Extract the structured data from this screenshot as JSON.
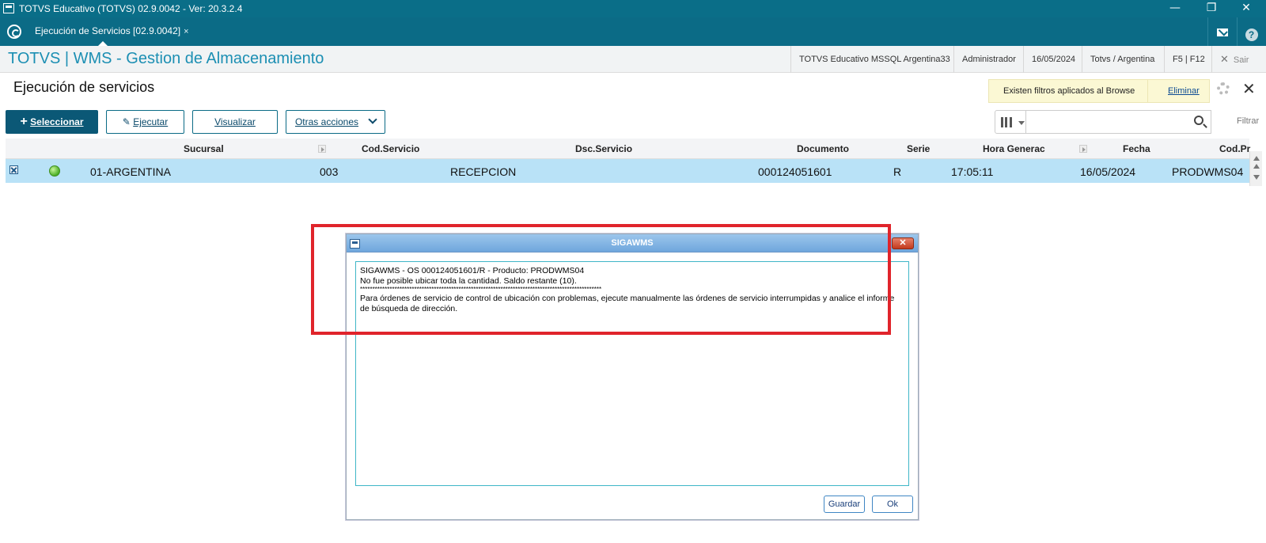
{
  "window": {
    "title": "TOTVS Educativo (TOTVS) 02.9.0042 - Ver: 20.3.2.4",
    "minimize_glyph": "—",
    "restore_glyph": "❐",
    "close_glyph": "✕"
  },
  "tabbar": {
    "active_tab": "Ejecución de Servicios [02.9.0042]",
    "tab_close": "×",
    "help_glyph": "?"
  },
  "header": {
    "module_title": "TOTVS | WMS - Gestion de Almacenamiento",
    "environment": "TOTVS Educativo MSSQL Argentina33",
    "user": "Administrador",
    "date": "16/05/2024",
    "company": "Totvs / Argentina",
    "shortcuts": "F5 | F12",
    "exit_label": "Sair",
    "exit_glyph": "✕"
  },
  "page": {
    "title": "Ejecución de servicios",
    "filter_notice": "Existen filtros aplicados al Browse",
    "filter_remove": "Eliminar",
    "close_glyph": "✕"
  },
  "toolbar": {
    "select_plus": "+",
    "select_label": "Seleccionar",
    "execute_glyph": "✎",
    "execute_label": "Ejecutar",
    "view_label": "Visualizar",
    "more_label": "Otras acciones",
    "filter_label": "Filtrar"
  },
  "grid": {
    "columns": {
      "sucursal": "Sucursal",
      "cod_servicio": "Cod.Servicio",
      "dsc_servicio": "Dsc.Servicio",
      "documento": "Documento",
      "serie": "Serie",
      "hora": "Hora Generac",
      "fecha": "Fecha",
      "cod_producto": "Cod.Pr"
    },
    "rows": [
      {
        "sucursal": "01-ARGENTINA",
        "cod_servicio": "003",
        "dsc_servicio": "RECEPCION",
        "documento": "000124051601",
        "serie": "R",
        "hora": "17:05:11",
        "fecha": "16/05/2024",
        "cod_producto": "PRODWMS04"
      }
    ]
  },
  "dialog": {
    "title": "SIGAWMS",
    "close_glyph": "✕",
    "lines": [
      "SIGAWMS - OS 000124051601/R - Producto: PRODWMS04",
      "No fue posible ubicar toda la cantidad. Saldo restante (10).",
      "**************************************************************************************************",
      "Para órdenes de servicio de control de ubicación con problemas, ejecute manualmente las órdenes de servicio interrumpidas y analice el informe de búsqueda de dirección."
    ],
    "save_label": "Guardar",
    "ok_label": "Ok"
  },
  "colors": {
    "titlebar": "#0a6e88",
    "accent": "#1c8fb3",
    "selected_row": "#b9e2f7",
    "highlight": "#e0242b"
  }
}
